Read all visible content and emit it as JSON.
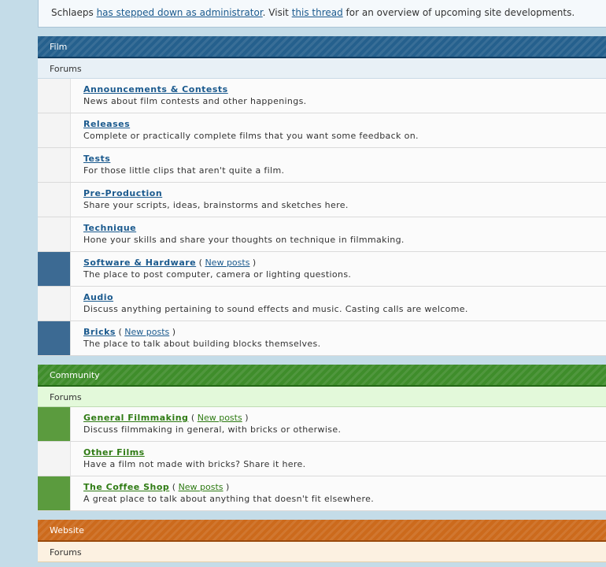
{
  "notice": {
    "prefix": "Schlaeps ",
    "link1": "has stepped down as administrator",
    "middle": ". Visit ",
    "link2": "this thread",
    "suffix": " for an overview of upcoming site developments."
  },
  "new_posts_label": "New posts",
  "categories": [
    {
      "title": "Film",
      "subheader": "Forums",
      "forums": [
        {
          "title": "Announcements & Contests",
          "desc": "News about film contests and other happenings.",
          "new": false
        },
        {
          "title": "Releases",
          "desc": "Complete or practically complete films that you want some feedback on.",
          "new": false
        },
        {
          "title": "Tests",
          "desc": "For those little clips that aren't quite a film.",
          "new": false
        },
        {
          "title": "Pre-Production",
          "desc": "Share your scripts, ideas, brainstorms and sketches here.",
          "new": false
        },
        {
          "title": "Technique",
          "desc": "Hone your skills and share your thoughts on technique in filmmaking.",
          "new": false
        },
        {
          "title": "Software & Hardware",
          "desc": "The place to post computer, camera or lighting questions.",
          "new": true
        },
        {
          "title": "Audio",
          "desc": "Discuss anything pertaining to sound effects and music. Casting calls are welcome.",
          "new": false
        },
        {
          "title": "Bricks",
          "desc": "The place to talk about building blocks themselves.",
          "new": true
        }
      ]
    },
    {
      "title": "Community",
      "subheader": "Forums",
      "forums": [
        {
          "title": "General Filmmaking",
          "desc": "Discuss filmmaking in general, with bricks or otherwise.",
          "new": true
        },
        {
          "title": "Other Films",
          "desc": "Have a film not made with bricks? Share it here.",
          "new": false
        },
        {
          "title": "The Coffee Shop",
          "desc": "A great place to talk about anything that doesn't fit elsewhere.",
          "new": true
        }
      ]
    },
    {
      "title": "Website",
      "subheader": "Forums",
      "forums": []
    }
  ]
}
